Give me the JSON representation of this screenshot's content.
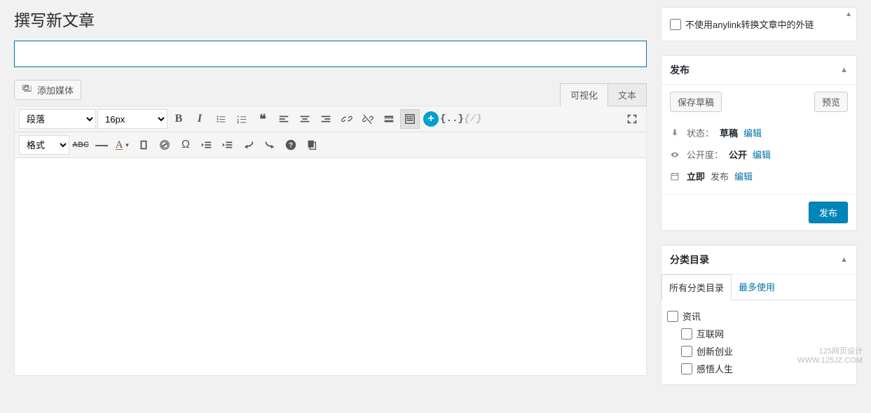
{
  "page": {
    "title": "撰写新文章"
  },
  "media_button": {
    "label": "添加媒体"
  },
  "title_input": {
    "placeholder": ""
  },
  "editor": {
    "tabs": {
      "visual": "可视化",
      "text": "文本"
    },
    "dropdowns": {
      "paragraph": "段落",
      "fontsize": "16px",
      "format": "格式"
    }
  },
  "anylink_panel": {
    "checkbox_label": "不使用anylink转换文章中的外链"
  },
  "publish_panel": {
    "title": "发布",
    "save_draft": "保存草稿",
    "preview": "预览",
    "status_label": "状态：",
    "status_value": "草稿",
    "status_edit": "编辑",
    "visibility_label": "公开度：",
    "visibility_value": "公开",
    "visibility_edit": "编辑",
    "schedule_label": "立即",
    "schedule_action": "发布",
    "schedule_edit": "编辑",
    "publish_btn": "发布"
  },
  "categories_panel": {
    "title": "分类目录",
    "tab_all": "所有分类目录",
    "tab_most": "最多使用",
    "items": [
      {
        "label": "资讯",
        "level": 0
      },
      {
        "label": "互联网",
        "level": 1
      },
      {
        "label": "创新创业",
        "level": 1
      },
      {
        "label": "感悟人生",
        "level": 1
      }
    ]
  },
  "watermark": {
    "line1": "125网页设计",
    "line2": "WWW.125JZ.COM"
  }
}
